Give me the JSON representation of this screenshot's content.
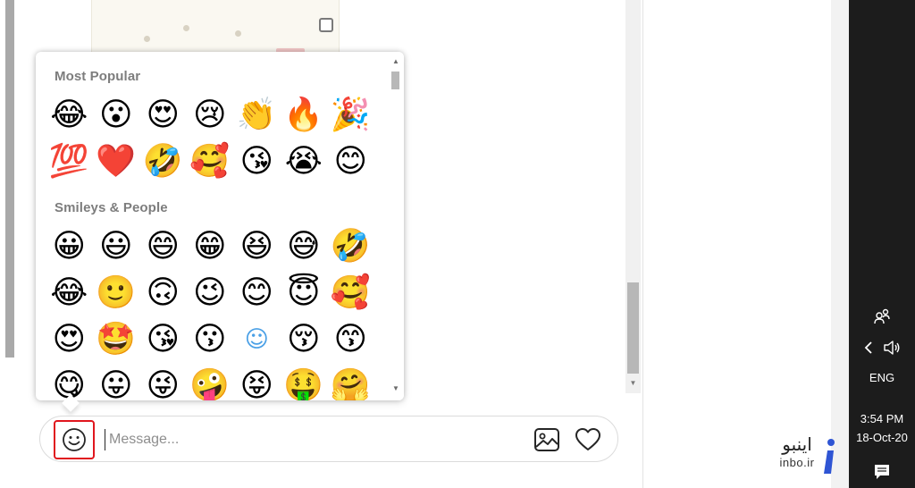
{
  "picker": {
    "sections": [
      {
        "title": "Most Popular",
        "rows": [
          [
            "😂",
            "😮",
            "😍",
            "😢",
            "👏",
            "🔥",
            "🎉"
          ],
          [
            "💯",
            "❤️",
            "🤣",
            "🥰",
            "😘",
            "😭",
            "😊"
          ]
        ]
      },
      {
        "title": "Smileys & People",
        "rows": [
          [
            "😀",
            "😃",
            "😄",
            "😁",
            "😆",
            "😅",
            "🤣"
          ],
          [
            "😂",
            "🙂",
            "🙃",
            "😉",
            "😊",
            "😇",
            "🥰"
          ],
          [
            "😍",
            "🤩",
            "😘",
            "😗",
            "☺",
            "😚",
            "😙"
          ],
          [
            "😋",
            "😛",
            "😜",
            "🤪",
            "😝",
            "🤑",
            "🤗"
          ]
        ]
      }
    ]
  },
  "composer": {
    "placeholder": "Message...",
    "value": "",
    "emoji_button_icon": "smiley-icon",
    "image_button_icon": "image-icon",
    "like_button_icon": "heart-icon",
    "highlight_color": "#e0161e"
  },
  "watermark": {
    "text": "اینبو",
    "domain": "inbo.ir",
    "logo": "info-i-logo",
    "logo_color": "#2f55d4"
  },
  "taskbar": {
    "people_icon": "people-icon",
    "chevron_icon": "chevron-left-icon",
    "volume_icon": "speaker-icon",
    "language": "ENG",
    "time": "3:54 PM",
    "date": "18-Oct-20",
    "action_center_icon": "notification-icon",
    "background": "#1c1c1c"
  }
}
